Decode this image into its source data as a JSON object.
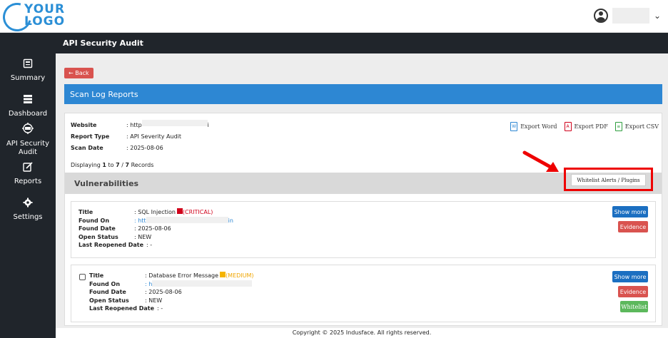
{
  "logo": {
    "line1": "YOUR",
    "line2": "LOGO"
  },
  "user": {
    "chevron": "⌄"
  },
  "sidebar": {
    "items": [
      {
        "label": "Summary",
        "icon": "summary-icon"
      },
      {
        "label": "Dashboard",
        "icon": "dashboard-icon"
      },
      {
        "label": "API Security Audit",
        "icon": "api-icon"
      },
      {
        "label": "Reports",
        "icon": "reports-icon"
      },
      {
        "label": "Settings",
        "icon": "gear-icon"
      }
    ]
  },
  "header": {
    "title": "API Security Audit"
  },
  "back_label": "← Back",
  "section_title": "Scan Log Reports",
  "report": {
    "website_label": "Website",
    "website_value": ": http",
    "website_suffix": "i",
    "type_label": "Report Type",
    "type_value": ": API Severity Audit",
    "date_label": "Scan Date",
    "date_value": ": 2025-08-06"
  },
  "exports": {
    "word": "Export Word",
    "pdf": "Export PDF",
    "csv": "Export CSV"
  },
  "displaying": {
    "prefix": "Displaying ",
    "range": "1",
    "to": " to ",
    "end": "7",
    "sep": " / ",
    "total": "7",
    "suffix": " Records"
  },
  "vulnerabilities": {
    "title": "Vulnerabilities",
    "whitelist_button": "Whitelist Alerts / Plugins"
  },
  "cards": [
    {
      "title_label": "Title",
      "title_value": ": SQL Injection",
      "severity": "(CRITICAL)",
      "found_on_label": "Found On",
      "found_on_value": ": htt",
      "found_on_suffix": "in",
      "found_date_label": "Found Date",
      "found_date_value": ": 2025-08-06",
      "open_status_label": "Open Status",
      "open_status_value": ": NEW",
      "reopened_label": "Last Reopened Date",
      "reopened_value": ": -"
    },
    {
      "title_label": "Title",
      "title_value": ": Database Error Message",
      "severity": "(MEDIUM)",
      "found_on_label": "Found On",
      "found_on_value": ": h",
      "found_date_label": "Found Date",
      "found_date_value": ": 2025-08-06",
      "open_status_label": "Open Status",
      "open_status_value": ": NEW",
      "reopened_label": "Last Reopened Date",
      "reopened_value": ": -"
    }
  ],
  "buttons": {
    "show_more": "Show more",
    "evidence": "Evidence",
    "whitelist": "Whitelist"
  },
  "footer": "Copyright © 2025 Indusface. All rights reserved.",
  "colors": {
    "primary_blue": "#2d87d3",
    "danger_red": "#d9534f",
    "success_green": "#5cb85c",
    "critical": "#d0021b",
    "medium": "#f5b400",
    "sidebar_dark": "#20252b"
  }
}
